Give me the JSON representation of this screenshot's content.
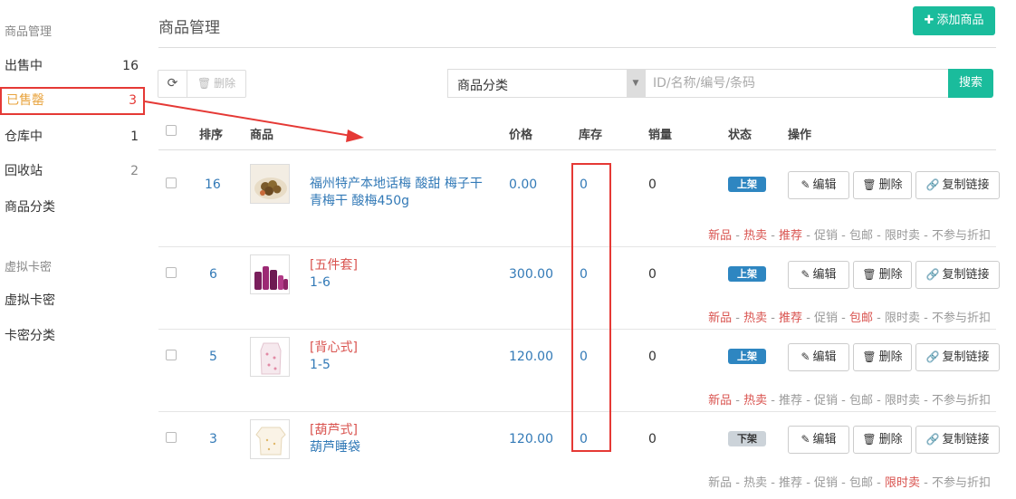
{
  "sidebar": {
    "section_goods": "商品管理",
    "section_virtual": "虚拟卡密",
    "items": [
      {
        "label": "出售中",
        "count": "16"
      },
      {
        "label": "已售罄",
        "count": "3"
      },
      {
        "label": "仓库中",
        "count": "1"
      },
      {
        "label": "回收站",
        "count": "2"
      },
      {
        "label": "商品分类",
        "count": ""
      },
      {
        "label": "虚拟卡密",
        "count": ""
      },
      {
        "label": "卡密分类",
        "count": ""
      }
    ]
  },
  "header": {
    "title": "商品管理",
    "add_button": "添加商品"
  },
  "toolbar": {
    "delete_label": "删除",
    "category_select": "商品分类",
    "search_placeholder": "ID/名称/编号/条码",
    "search_button": "搜索"
  },
  "table": {
    "columns": {
      "sort": "排序",
      "product": "商品",
      "price": "价格",
      "stock": "库存",
      "sales": "销量",
      "status": "状态",
      "actions": "操作"
    },
    "actions": {
      "edit": "编辑",
      "delete": "删除",
      "copy": "复制链接"
    },
    "tag_labels": [
      "新品",
      "热卖",
      "推荐",
      "促销",
      "包邮",
      "限时卖",
      "不参与折扣"
    ],
    "rows": [
      {
        "sort": "16",
        "tag": "",
        "name": "福州特产本地话梅 酸甜 梅子干 青梅干 酸梅450g",
        "price": "0.00",
        "stock": "0",
        "sales": "0",
        "status": "上架",
        "active_tags": [
          0,
          1,
          2
        ]
      },
      {
        "sort": "6",
        "tag": "[五件套]",
        "name": "1-6",
        "price": "300.00",
        "stock": "0",
        "sales": "0",
        "status": "上架",
        "active_tags": [
          0,
          1,
          2,
          4
        ]
      },
      {
        "sort": "5",
        "tag": "[背心式]",
        "name": "1-5",
        "price": "120.00",
        "stock": "0",
        "sales": "0",
        "status": "上架",
        "active_tags": [
          0,
          1
        ]
      },
      {
        "sort": "3",
        "tag": "[葫芦式]",
        "name": "葫芦睡袋",
        "price": "120.00",
        "stock": "0",
        "sales": "0",
        "status": "下架",
        "active_tags": [
          5
        ]
      }
    ]
  },
  "colors": {
    "accent": "#1abc9c",
    "link": "#337ab7",
    "highlight_red": "#e53935",
    "status_on": "#2e86c1",
    "status_off": "#ccd3d9"
  }
}
